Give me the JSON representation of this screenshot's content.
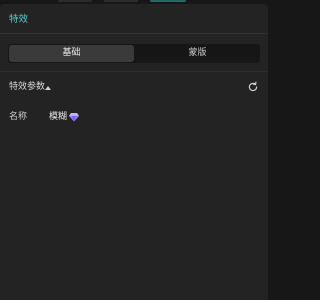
{
  "panel": {
    "title": "特效"
  },
  "tabs": [
    {
      "label": "基础",
      "active": true
    },
    {
      "label": "蒙版",
      "active": false
    }
  ],
  "section": {
    "title": "特效参数",
    "collapse_icon": "caret-up-icon",
    "reset_icon": "reset-icon"
  },
  "property": {
    "label": "名称",
    "value": "模糊",
    "badge_icon": "gem-icon"
  },
  "colors": {
    "accent": "#4fd0d6",
    "panel_bg": "#232323",
    "page_bg": "#171717",
    "gem": "#9b7bff"
  }
}
